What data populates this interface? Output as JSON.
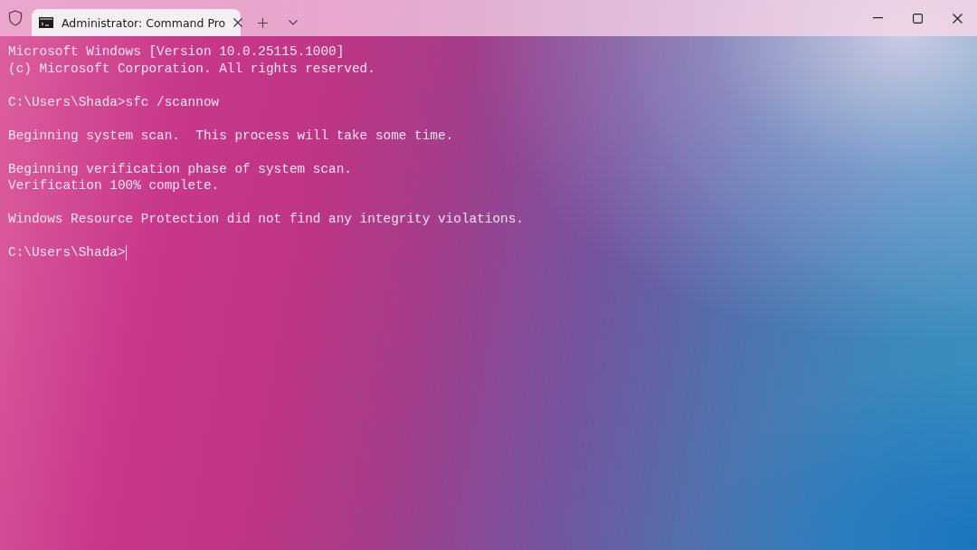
{
  "window": {
    "tabs": [
      {
        "title": "Administrator: Command Pro",
        "selected": true
      }
    ],
    "controls": [
      {
        "kind": "minimize"
      },
      {
        "kind": "maximize"
      },
      {
        "kind": "close"
      }
    ]
  },
  "terminal": {
    "blocks": [
      [
        "Microsoft Windows [Version 10.0.25115.1000]",
        "(c) Microsoft Corporation. All rights reserved."
      ],
      [
        "C:\\Users\\Shada>sfc /scannow"
      ],
      [
        "Beginning system scan.  This process will take some time."
      ],
      [
        "Beginning verification phase of system scan.",
        "Verification 100% complete."
      ],
      [
        "Windows Resource Protection did not find any integrity violations."
      ],
      [
        "C:\\Users\\Shada>"
      ]
    ],
    "cursor": true
  }
}
